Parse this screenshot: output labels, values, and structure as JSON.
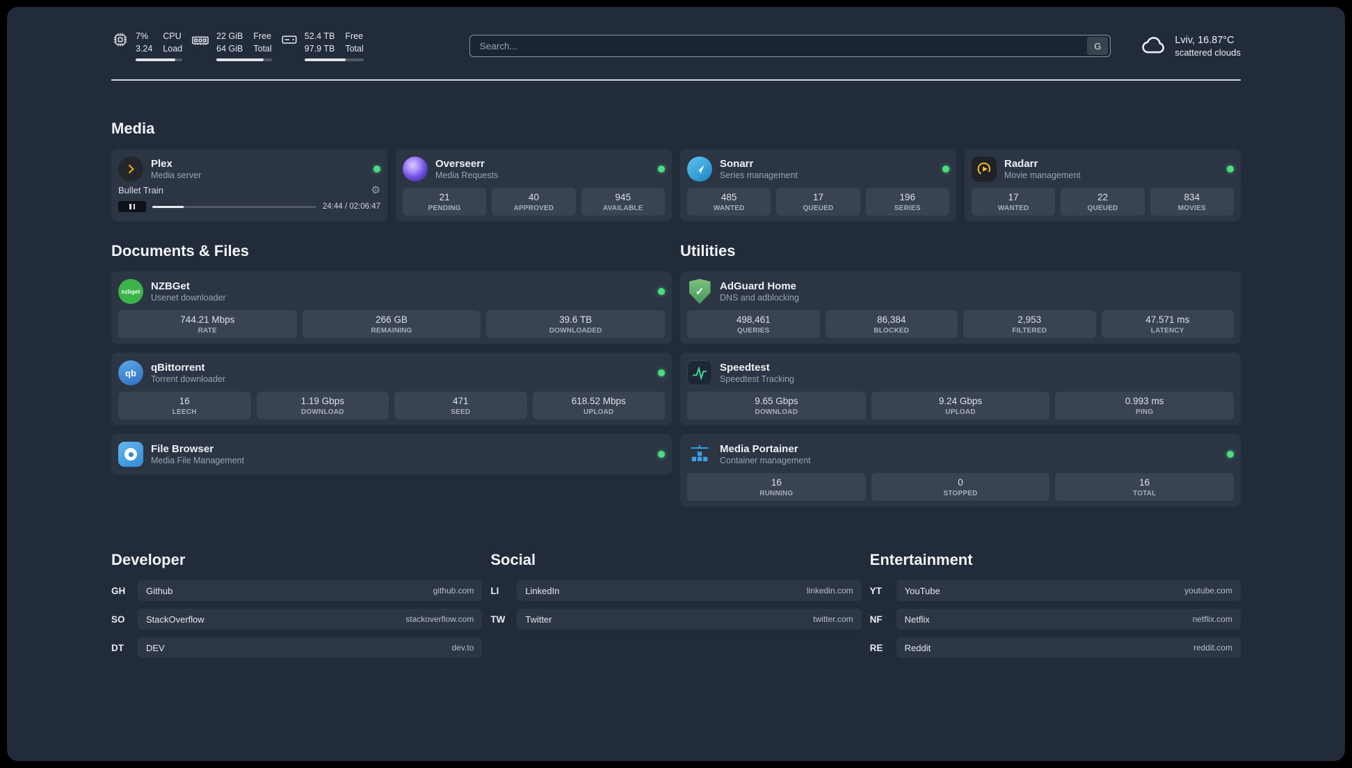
{
  "topbar": {
    "cpu": {
      "value_top": "7%",
      "value_bottom": "3.24",
      "label_top": "CPU",
      "label_bottom": "Load",
      "bar_percent": 85
    },
    "ram": {
      "value_top": "22 GiB",
      "value_bottom": "64 GiB",
      "label_top": "Free",
      "label_bottom": "Total",
      "bar_percent": 85
    },
    "disk": {
      "value_top": "52.4 TB",
      "value_bottom": "97.9 TB",
      "label_top": "Free",
      "label_bottom": "Total",
      "bar_percent": 70
    },
    "search": {
      "placeholder": "Search...",
      "button_label": "G"
    },
    "weather": {
      "location": "Lviv, 16.87°C",
      "condition": "scattered clouds"
    }
  },
  "sections": {
    "media": {
      "title": "Media"
    },
    "documents": {
      "title": "Documents & Files"
    },
    "utilities": {
      "title": "Utilities"
    }
  },
  "services": {
    "plex": {
      "name": "Plex",
      "subtitle": "Media server",
      "online": true,
      "player": {
        "track": "Bullet Train",
        "time": "24:44 / 02:06:47",
        "progress_percent": 19
      }
    },
    "overseerr": {
      "name": "Overseerr",
      "subtitle": "Media Requests",
      "online": true,
      "stats": [
        {
          "value": "21",
          "label": "PENDING"
        },
        {
          "value": "40",
          "label": "APPROVED"
        },
        {
          "value": "945",
          "label": "AVAILABLE"
        }
      ]
    },
    "sonarr": {
      "name": "Sonarr",
      "subtitle": "Series management",
      "online": true,
      "stats": [
        {
          "value": "485",
          "label": "WANTED"
        },
        {
          "value": "17",
          "label": "QUEUED"
        },
        {
          "value": "196",
          "label": "SERIES"
        }
      ]
    },
    "radarr": {
      "name": "Radarr",
      "subtitle": "Movie management",
      "online": true,
      "stats": [
        {
          "value": "17",
          "label": "WANTED"
        },
        {
          "value": "22",
          "label": "QUEUED"
        },
        {
          "value": "834",
          "label": "MOVIES"
        }
      ]
    },
    "nzbget": {
      "name": "NZBGet",
      "subtitle": "Usenet downloader",
      "online": true,
      "stats": [
        {
          "value": "744.21 Mbps",
          "label": "RATE"
        },
        {
          "value": "266 GB",
          "label": "REMAINING"
        },
        {
          "value": "39.6 TB",
          "label": "DOWNLOADED"
        }
      ]
    },
    "qbittorrent": {
      "name": "qBittorrent",
      "subtitle": "Torrent downloader",
      "online": true,
      "stats": [
        {
          "value": "16",
          "label": "LEECH"
        },
        {
          "value": "1.19 Gbps",
          "label": "DOWNLOAD"
        },
        {
          "value": "471",
          "label": "SEED"
        },
        {
          "value": "618.52 Mbps",
          "label": "UPLOAD"
        }
      ]
    },
    "filebrowser": {
      "name": "File Browser",
      "subtitle": "Media File Management",
      "online": true
    },
    "adguard": {
      "name": "AdGuard Home",
      "subtitle": "DNS and adblocking",
      "stats": [
        {
          "value": "498,461",
          "label": "QUERIES"
        },
        {
          "value": "86,384",
          "label": "BLOCKED"
        },
        {
          "value": "2,953",
          "label": "FILTERED"
        },
        {
          "value": "47.571 ms",
          "label": "LATENCY"
        }
      ]
    },
    "speedtest": {
      "name": "Speedtest",
      "subtitle": "Speedtest Tracking",
      "stats": [
        {
          "value": "9.65 Gbps",
          "label": "DOWNLOAD"
        },
        {
          "value": "9.24 Gbps",
          "label": "UPLOAD"
        },
        {
          "value": "0.993 ms",
          "label": "PING"
        }
      ]
    },
    "portainer": {
      "name": "Media Portainer",
      "subtitle": "Container management",
      "online": true,
      "stats": [
        {
          "value": "16",
          "label": "RUNNING"
        },
        {
          "value": "0",
          "label": "STOPPED"
        },
        {
          "value": "16",
          "label": "TOTAL"
        }
      ]
    }
  },
  "links": {
    "developer": {
      "title": "Developer",
      "items": [
        {
          "abbr": "GH",
          "name": "Github",
          "url": "github.com"
        },
        {
          "abbr": "SO",
          "name": "StackOverflow",
          "url": "stackoverflow.com"
        },
        {
          "abbr": "DT",
          "name": "DEV",
          "url": "dev.to"
        }
      ]
    },
    "social": {
      "title": "Social",
      "items": [
        {
          "abbr": "LI",
          "name": "LinkedIn",
          "url": "linkedin.com"
        },
        {
          "abbr": "TW",
          "name": "Twitter",
          "url": "twitter.com"
        }
      ]
    },
    "entertainment": {
      "title": "Entertainment",
      "items": [
        {
          "abbr": "YT",
          "name": "YouTube",
          "url": "youtube.com"
        },
        {
          "abbr": "NF",
          "name": "Netflix",
          "url": "netflix.com"
        },
        {
          "abbr": "RE",
          "name": "Reddit",
          "url": "reddit.com"
        }
      ]
    }
  },
  "icons": {
    "gear": "⚙",
    "check": "✓",
    "nzbget_label": "nzbget",
    "qb_label": "qb"
  },
  "colors": {
    "status_online": "#4ade80",
    "plex_gold": "#e5a00d",
    "radarr_gold": "#ffc230",
    "speedtest_green": "#3ddc97",
    "portainer_blue": "#3aa2e6"
  }
}
